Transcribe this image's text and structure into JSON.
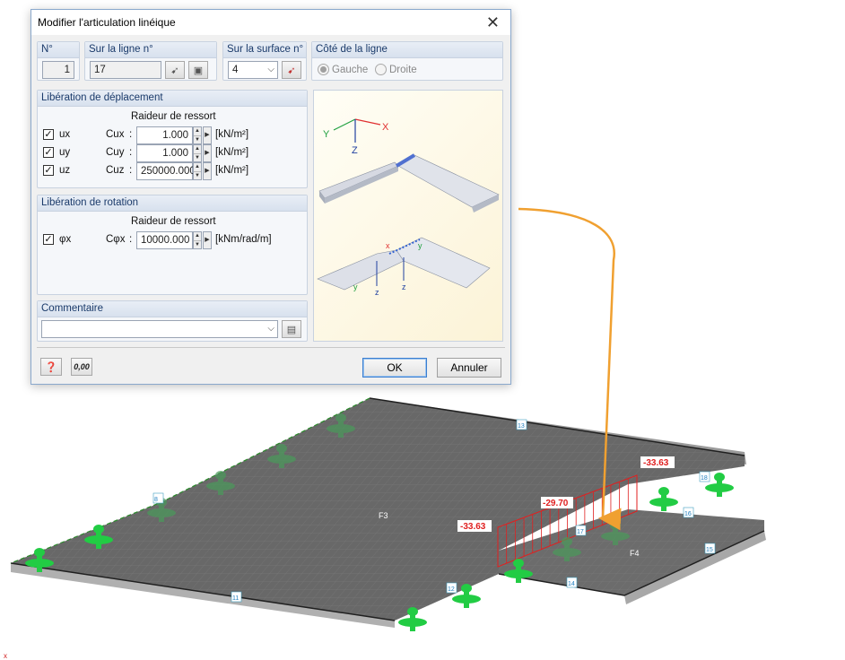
{
  "dialog": {
    "title": "Modifier l'articulation linéique",
    "number": {
      "header": "N°",
      "value": "1"
    },
    "line": {
      "header": "Sur la ligne n°",
      "value": "17"
    },
    "surface": {
      "header": "Sur la surface n°",
      "value": "4"
    },
    "side": {
      "header": "Côté de la ligne",
      "options": [
        "Gauche",
        "Droite"
      ],
      "selected": "Gauche"
    },
    "displacement": {
      "header": "Libération de déplacement",
      "stiffness_title": "Raideur de ressort",
      "rows": [
        {
          "dof": "ux",
          "param": "Cux",
          "value": "1.000",
          "unit": "[kN/m²]",
          "checked": true
        },
        {
          "dof": "uy",
          "param": "Cuy",
          "value": "1.000",
          "unit": "[kN/m²]",
          "checked": true
        },
        {
          "dof": "uz",
          "param": "Cuz",
          "value": "250000.000",
          "unit": "[kN/m²]",
          "checked": true
        }
      ]
    },
    "rotation": {
      "header": "Libération de rotation",
      "stiffness_title": "Raideur de ressort",
      "rows": [
        {
          "dof": "φx",
          "param": "Cφx",
          "value": "10000.000",
          "unit": "[kNm/rad/m]",
          "checked": true
        }
      ]
    },
    "comment": {
      "header": "Commentaire",
      "value": ""
    },
    "illustration": {
      "axis_x": "X",
      "axis_y": "Y",
      "axis_z": "Z",
      "small_x": "x",
      "small_y": "y",
      "small_z": "z"
    },
    "ok_label": "OK",
    "cancel_label": "Annuler",
    "units_label": "0,00"
  },
  "model": {
    "surface_labels": [
      "F3",
      "F4"
    ],
    "line_labels": [
      "13",
      "8",
      "11",
      "12",
      "14",
      "15",
      "16",
      "17",
      "18"
    ],
    "values": [
      "-33.63",
      "-29.70",
      "-33.63"
    ],
    "axis_corner": "x"
  },
  "colors": {
    "accent": "#3c7fd0",
    "support": "#22cc44",
    "diagram": "#e02020",
    "slab": "#6a6a6a",
    "arrow": "#f0a030"
  }
}
